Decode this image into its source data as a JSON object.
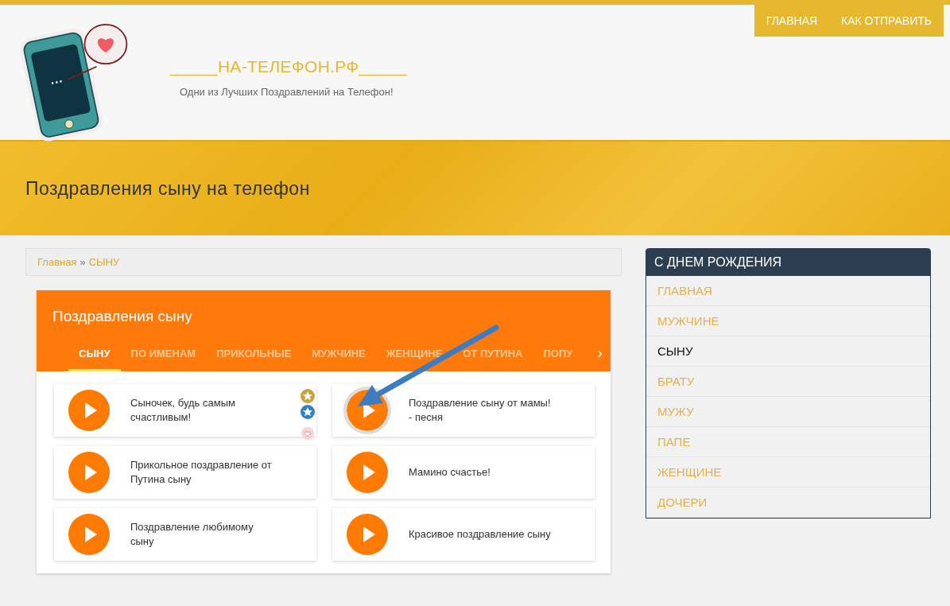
{
  "top_nav": [
    {
      "label": "ГЛАВНАЯ"
    },
    {
      "label": "КАК ОТПРАВИТЬ"
    }
  ],
  "site": {
    "title": "_____НА-ТЕЛЕФОН.РФ_____",
    "tagline": "Одни из Лучших Поздравлений на Телефон!"
  },
  "banner": {
    "title": "Поздравления сыну на телефон"
  },
  "breadcrumb": {
    "items": [
      "Главная",
      "СЫНУ"
    ],
    "separator": "»"
  },
  "panel": {
    "title": "Поздравления сыну",
    "tabs": [
      {
        "label": "СЫНУ",
        "selected": true
      },
      {
        "label": "ПО ИМЕНАМ",
        "selected": false
      },
      {
        "label": "ПРИКОЛЬНЫЕ",
        "selected": false
      },
      {
        "label": "МУЖЧИНЕ",
        "selected": false
      },
      {
        "label": "ЖЕНЩИНЕ",
        "selected": false
      },
      {
        "label": "ОТ ПУТИНА",
        "selected": false
      },
      {
        "label": "ПОПУ",
        "selected": false
      }
    ],
    "tab_next": "›",
    "items": [
      {
        "title": "Сыночек, будь самым счастливым!",
        "share_icons": true
      },
      {
        "title": "Поздравление сыну от мамы! - песня",
        "share_icons": false
      },
      {
        "title": "Прикольное поздравление от Путина сыну",
        "share_icons": false
      },
      {
        "title": "Мамино счастье!",
        "share_icons": false
      },
      {
        "title": "Поздравление любимому сыну",
        "share_icons": false
      },
      {
        "title": "Красивое поздравление сыну",
        "share_icons": false
      }
    ]
  },
  "sidebar": {
    "title": "С ДНЕМ РОЖДЕНИЯ",
    "items": [
      {
        "label": "ГЛАВНАЯ",
        "selected": false
      },
      {
        "label": "МУЖЧИНЕ",
        "selected": false
      },
      {
        "label": "СЫНУ",
        "selected": true
      },
      {
        "label": "БРАТУ",
        "selected": false
      },
      {
        "label": "МУЖУ",
        "selected": false
      },
      {
        "label": "ПАПЕ",
        "selected": false
      },
      {
        "label": "ЖЕНЩИНЕ",
        "selected": false
      },
      {
        "label": "ДОЧЕРИ",
        "selected": false
      }
    ]
  }
}
